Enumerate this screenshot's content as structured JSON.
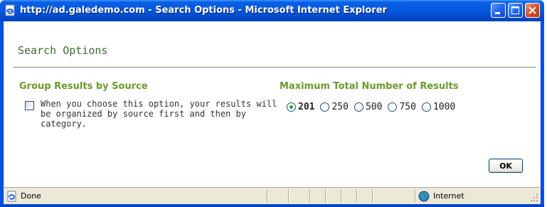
{
  "window": {
    "title": "http://ad.galedemo.com - Search Options - Microsoft Internet Explorer"
  },
  "dialog": {
    "heading": "Search Options",
    "group": {
      "title": "Group Results by Source",
      "checked": false,
      "description": "When you choose this option, your results will be organized by source first and then by category."
    },
    "max_results": {
      "title": "Maximum Total Number of Results",
      "options": [
        {
          "label": "201",
          "selected": true
        },
        {
          "label": "250",
          "selected": false
        },
        {
          "label": "500",
          "selected": false
        },
        {
          "label": "750",
          "selected": false
        },
        {
          "label": "1000",
          "selected": false
        }
      ]
    },
    "ok_label": "OK"
  },
  "statusbar": {
    "status": "Done",
    "zone": "Internet"
  },
  "icons": {
    "page": "ie-page-icon",
    "zone": "globe-icon"
  },
  "colors": {
    "titlebar": "#0458dc",
    "section_title": "#6b9a2a",
    "heading": "#3b6b2f",
    "selected_radio": "#21a121"
  }
}
